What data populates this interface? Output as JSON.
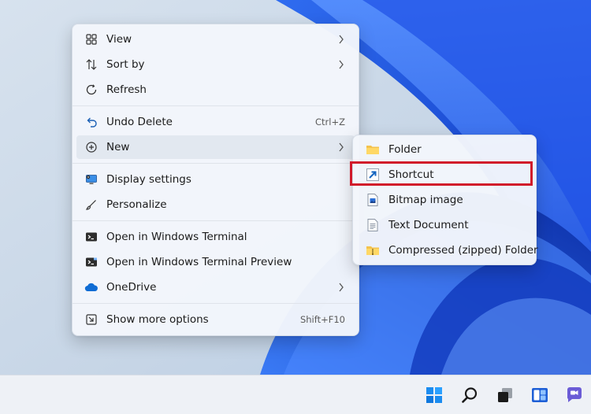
{
  "context_menu": {
    "items": [
      {
        "label": "View",
        "icon": "grid-view-icon",
        "submenu": true
      },
      {
        "label": "Sort by",
        "icon": "sort-icon",
        "submenu": true
      },
      {
        "label": "Refresh",
        "icon": "refresh-icon"
      },
      {
        "label": "Undo Delete",
        "icon": "undo-icon",
        "shortcut": "Ctrl+Z"
      },
      {
        "label": "New",
        "icon": "plus-circle-icon",
        "submenu": true
      },
      {
        "label": "Display settings",
        "icon": "display-settings-icon"
      },
      {
        "label": "Personalize",
        "icon": "brush-icon"
      },
      {
        "label": "Open in Windows Terminal",
        "icon": "terminal-icon"
      },
      {
        "label": "Open in Windows Terminal Preview",
        "icon": "terminal-preview-icon"
      },
      {
        "label": "OneDrive",
        "icon": "onedrive-cloud-icon",
        "submenu": true
      },
      {
        "label": "Show more options",
        "icon": "show-more-icon",
        "shortcut": "Shift+F10"
      }
    ]
  },
  "new_submenu": {
    "items": [
      {
        "label": "Folder",
        "icon": "folder-icon"
      },
      {
        "label": "Shortcut",
        "icon": "shortcut-icon"
      },
      {
        "label": "Bitmap image",
        "icon": "bitmap-image-icon"
      },
      {
        "label": "Text Document",
        "icon": "text-document-icon"
      },
      {
        "label": "Compressed (zipped) Folder",
        "icon": "zip-folder-icon"
      }
    ]
  },
  "taskbar": {
    "icons": [
      "start-icon",
      "search-icon",
      "task-view-icon",
      "widgets-icon",
      "chat-icon"
    ]
  },
  "colors": {
    "highlight": "#d11a2a",
    "hover": "#e2e8f0",
    "accent": "#0067c0"
  }
}
